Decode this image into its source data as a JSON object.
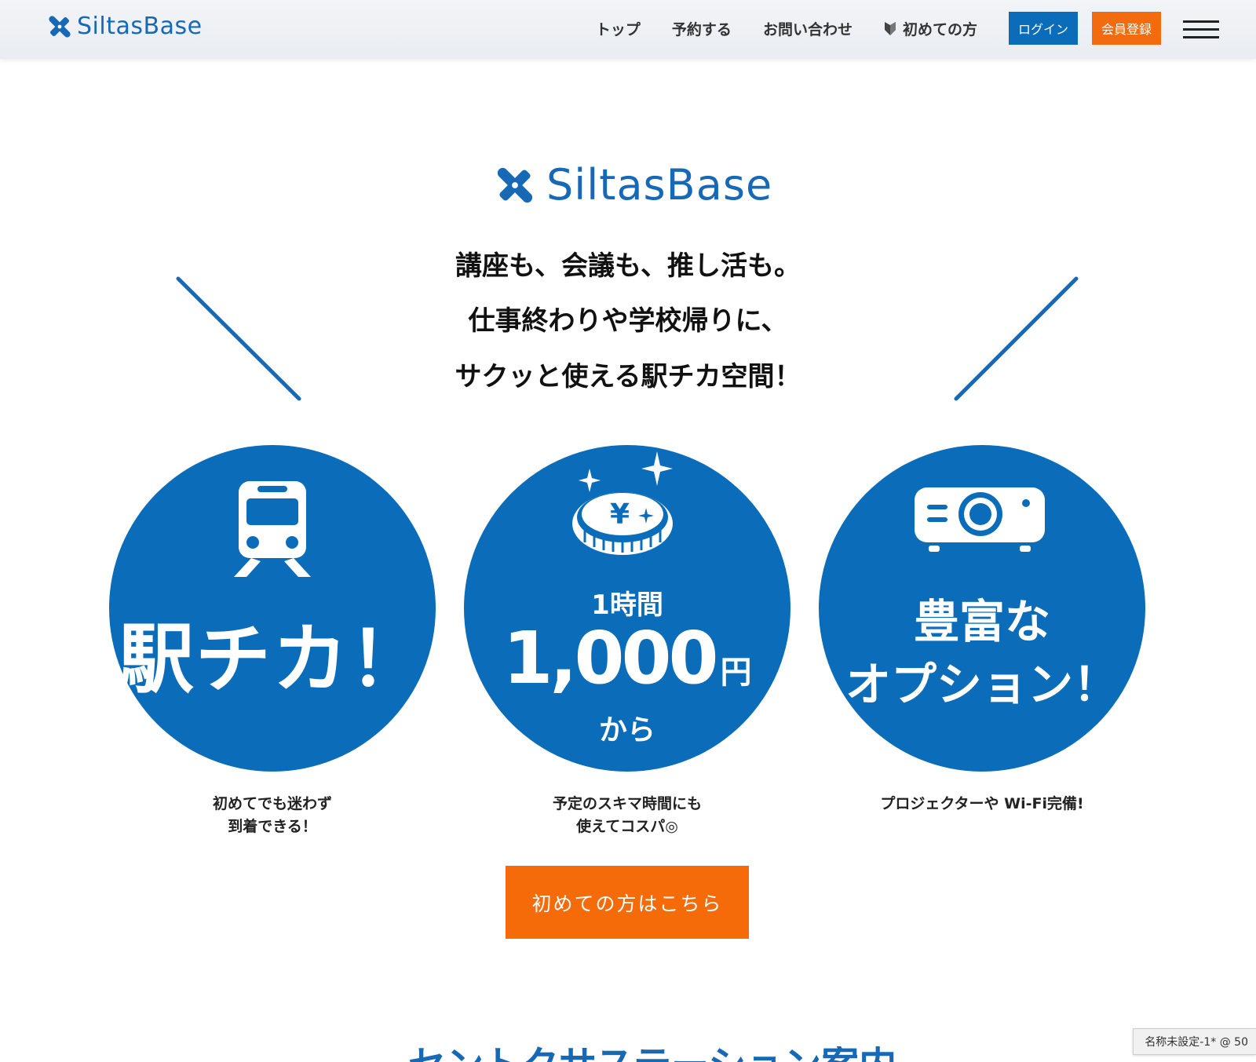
{
  "header": {
    "logo_text": "SiltasBase",
    "nav": [
      {
        "label": "トップ"
      },
      {
        "label": "予約する"
      },
      {
        "label": "お問い合わせ"
      },
      {
        "label": "初めての方"
      }
    ],
    "login_label": "ログイン",
    "signup_label": "会員登録"
  },
  "hero": {
    "logo_text": "SiltasBase",
    "tagline": [
      "講座も、会議も、推し活も。",
      "仕事終わりや学校帰りに、",
      "サクッと使える駅チカ空間！"
    ]
  },
  "features": [
    {
      "icon": "train-icon",
      "title": "駅チカ！",
      "caption": [
        "初めてでも迷わず",
        "到着できる！"
      ]
    },
    {
      "icon": "yen-coin-icon",
      "pre": "1時間",
      "price": "1,000",
      "unit": "円",
      "post": "から",
      "caption": [
        "予定のスキマ時間にも",
        "使えてコスパ◎"
      ]
    },
    {
      "icon": "projector-icon",
      "title": [
        "豊富な",
        "オプション！"
      ],
      "caption": [
        "プロジェクターや Wi-Fi完備!"
      ]
    }
  ],
  "cta_label": "初めての方はこちら",
  "app_badge": "名称未設定-1* @ 50",
  "next_heading": "セントクサステーション案内",
  "colors": {
    "brand_blue": "#0b6cba",
    "accent_orange": "#f56a09",
    "logo_blue": "#1769b6"
  }
}
